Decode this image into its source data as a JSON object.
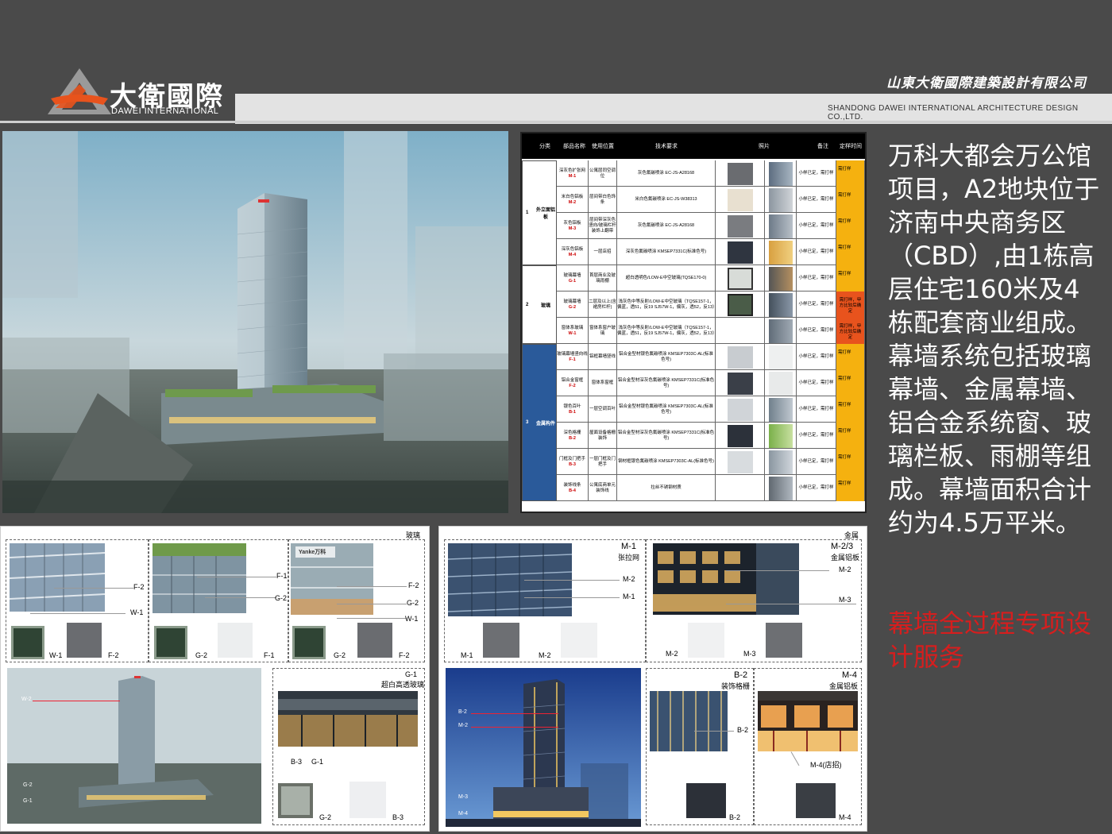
{
  "header": {
    "logo_cn": "大衛國際",
    "logo_en": "DAWEI INTERNATIONAL",
    "company_cn": "山東大衛國際建築設計有限公司",
    "company_en": "SHANDONG DAWEI INTERNATIONAL ARCHITECTURE DESIGN CO.,LTD."
  },
  "table": {
    "headers": [
      "分类",
      "部品名称",
      "使用位置",
      "技术要求",
      "照片",
      "备注",
      "定样时间"
    ],
    "categories": [
      {
        "idx": "1",
        "name": "外立面铝板"
      },
      {
        "idx": "2",
        "name": "玻璃"
      },
      {
        "idx": "3",
        "name": "金属构件"
      }
    ],
    "rows": [
      {
        "name": "深灰色扩张网",
        "code": "M-1",
        "loc": "公寓层同空调位",
        "req": "灰色氟碳喷涂 EC-JS-A28168",
        "note": "小样已定，需打样",
        "time": "需打样"
      },
      {
        "name": "米白色铝板",
        "code": "M-2",
        "loc": "层间带白色饰条",
        "req": "米白色氟碳喷涂 EC-JS-W38313",
        "note": "小样已定，需打样",
        "time": "需打样"
      },
      {
        "name": "灰色铝板",
        "code": "M-3",
        "loc": "层间带深灰色竖向/玻璃栏杆装饰上翻带",
        "req": "灰色氟碳喷涂 EC-JS-A28168",
        "note": "小样已定，需打样",
        "time": "需打样"
      },
      {
        "name": "深灰色铝板",
        "code": "M-4",
        "loc": "一层店招",
        "req": "深灰色氟碳喷涂 KMSEP7331C(标准色号)",
        "note": "小样已定，需打样",
        "time": "需打样"
      },
      {
        "name": "玻璃幕墙",
        "code": "G-1",
        "loc": "首层商业及玻璃雨棚",
        "req": "超白透明色/LOW-E中空玻璃(TQSE170-0)",
        "note": "小样已定，需打样",
        "time": "需打样"
      },
      {
        "name": "玻璃幕墙",
        "code": "G-2",
        "loc": "二层及以上(含裙房栏杆)",
        "req": "浅灰色中等反射/LOW-E中空玻璃（TQSE157-1，偏蓝，透51，反19 SJ57W-1，偏灰，透52，反13）",
        "note": "小样已定，需打样",
        "time": "需打样，甲方比较后确定"
      },
      {
        "name": "窗体系玻璃",
        "code": "W-1",
        "loc": "窗体系窗户玻璃",
        "req": "浅灰色中等反射/LOW-E中空玻璃（TQSE157-1，偏蓝，透51，反19 SJ57W-1，偏灰，透52，反13）",
        "note": "小样已定，需打样",
        "time": "需打样，甲方比较后确定"
      },
      {
        "name": "玻璃幕墙竖向线",
        "code": "F-1",
        "loc": "铝框幕墙竖线",
        "req": "铝合金型材银色氟碳喷涂 KMSEP7303C-AL(标准色号)",
        "note": "小样已定，需打样",
        "time": "需打样"
      },
      {
        "name": "铝合金窗框",
        "code": "F-2",
        "loc": "窗体系窗框",
        "req": "铝合金型材深灰色氟碳喷涂 KMSEP7331C(标准色号)",
        "note": "小样已定，需打样",
        "time": "需打样"
      },
      {
        "name": "银色百叶",
        "code": "B-1",
        "loc": "一层空调百叶",
        "req": "铝合金型材银色氟碳喷涂 KMSEP7303C-AL(标准色号)",
        "note": "小样已定，需打样",
        "time": "需打样"
      },
      {
        "name": "深色格栅",
        "code": "B-2",
        "loc": "屋面设备格栅装饰",
        "req": "铝合金型材深灰色氟碳喷涂 KMSEP7331C(标准色号)",
        "note": "小样已定，需打样",
        "time": "需打样"
      },
      {
        "name": "门框及门把手",
        "code": "B-3",
        "loc": "一层门框及门把手",
        "req": "钢材框银色氟碳喷涂 KMSEP7303C-AL(标准色号)",
        "note": "小样已定，需打样",
        "time": "需打样"
      },
      {
        "name": "装饰线条",
        "code": "B-4",
        "loc": "公寓底商单元装饰线",
        "req": "拉丝不锈钢材质",
        "note": "小样已定，需打样",
        "time": "需打样"
      }
    ]
  },
  "description": {
    "main": "万科大都会万公馆项目，A2地块位于济南中央商务区（CBD）,由1栋高层住宅160米及4栋配套商业组成。幕墙系统包括玻璃幕墙、金属幕墙、铝合金系统窗、玻璃栏板、雨棚等组成。幕墙面积合计约为4.5万平米。",
    "highlight": "幕墙全过程专项设计服务"
  },
  "glass_panel": {
    "title": "玻璃",
    "labels": {
      "f2": "F-2",
      "w1": "W-1",
      "f1": "F-1",
      "g2": "G-2",
      "w2": "W-2",
      "g1": "G-1",
      "b3": "B-3",
      "g1_title": "G-1",
      "g1_desc": "超白高透玻璃",
      "sign": "Yanke万科"
    }
  },
  "metal_panel": {
    "title": "金属",
    "labels": {
      "m1": "M-1",
      "m1_desc": "张拉网",
      "m2": "M-2",
      "m23": "M-2/3",
      "m23_desc": "金属铝板",
      "m3": "M-3",
      "b2": "B-2",
      "b2_desc": "装饰格栅",
      "m4": "M-4",
      "m4_desc": "金属铝板",
      "m4_sign": "M-4(店招)"
    }
  },
  "colors": {
    "background": "#4a4a4a",
    "accent_orange": "#e8531d",
    "table_highlight": "#f5b10f",
    "highlight_text": "#d61e1e"
  }
}
